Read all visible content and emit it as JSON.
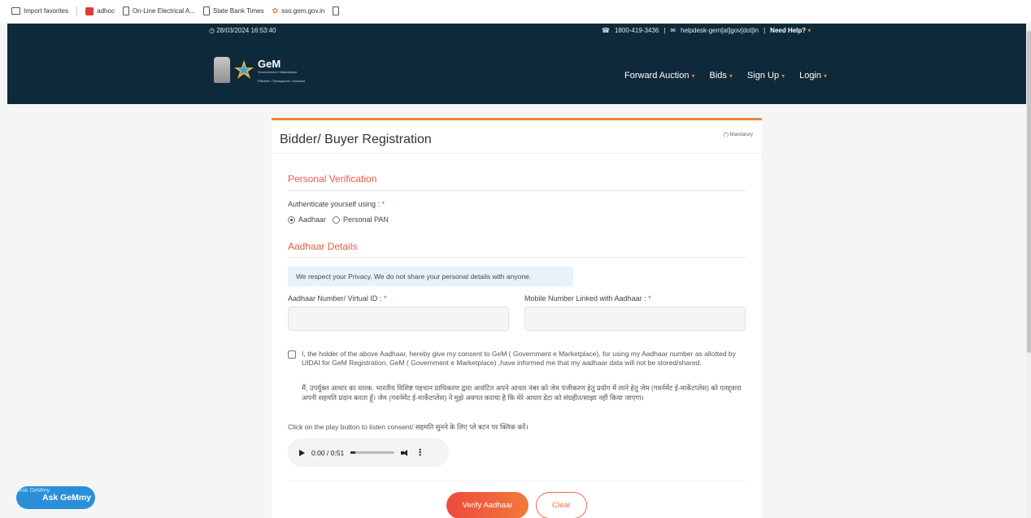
{
  "bookmarks": [
    {
      "label": "Import favorites",
      "icon": "folder-icon"
    },
    {
      "label": "adhoc",
      "icon": "adhoc-icon"
    },
    {
      "label": "On-Line Electrical A...",
      "icon": "page-icon"
    },
    {
      "label": "State Bank Times",
      "icon": "page-icon"
    },
    {
      "label": "sso.gem.gov.in",
      "icon": "gem-favicon-icon"
    }
  ],
  "header": {
    "datetime": "28/03/2024 16:53:40",
    "phone": "1800-419-3436",
    "separator": "|",
    "email": "helpdesk-gem[at]gov[dot]in",
    "help": "Need Help?",
    "logo_title": "GeM",
    "logo_subtitle": "Government e Marketplace",
    "logo_tagline": "Efficient • Transparent • Inclusive",
    "nav": [
      "Forward Auction",
      "Bids",
      "Sign Up",
      "Login"
    ]
  },
  "form": {
    "title": "Bidder/ Buyer Registration",
    "mandatory_note": "(*) Mandatory",
    "personal_section": "Personal Verification",
    "auth_label": "Authenticate yourself using :",
    "required_mark": "*",
    "radio_aadhaar": "Aadhaar",
    "radio_pan": "Personal PAN",
    "aadhaar_section": "Aadhaar Details",
    "privacy": "We respect your Privacy. We do not share your personal details with anyone.",
    "aadhaar_label": "Aadhaar Number/ Virtual ID :",
    "mobile_label": "Mobile Number Linked with Aadhaar :",
    "consent_en": "I, the holder of the above Aadhaar, hereby give my consent to GeM ( Government e Marketplace), for using my Aadhaar number as allotted by UIDAI for GeM Registration. GeM ( Government e Marketplace) ,have informed me that my aadhaar data will not be stored/shared.",
    "consent_hi": "मैं, उपर्युक्त आधार का धारक, भारतीय विशिष्ट पहचान प्राधिकरण द्वारा आवंटित अपने आधार नंबर को जेम पंजीकरण हेतु प्रयोग में लाने हेतु जेम (गवर्नमेंट ई-मार्केटप्लेस) को एतद्द्वारा अपनी सहमति प्रदान करता हूँ। जेम (गवर्नमेंट ई-मार्केटप्लेस) ने मुझे अवगत कराया है कि मेरे आधार डेटा को संग्रहीत/साझा नहीं किया जाएगा।",
    "listen_text": "Click on the play button to listen consent/ सहमति सुनने के लिए प्ले बटन पर क्लिक करें।",
    "audio_time": "0:00 / 0:51",
    "verify_button": "Verify Aadhaar",
    "clear_button": "Clear"
  },
  "chatbot": {
    "label": "Ask GeMmy",
    "img_alt": "Ask GeMmy"
  },
  "colors": {
    "header_bg": "#0e2a3a",
    "accent": "#f0853c",
    "section_title": "#e25d4a",
    "chat_button": "#2a8fd8"
  }
}
